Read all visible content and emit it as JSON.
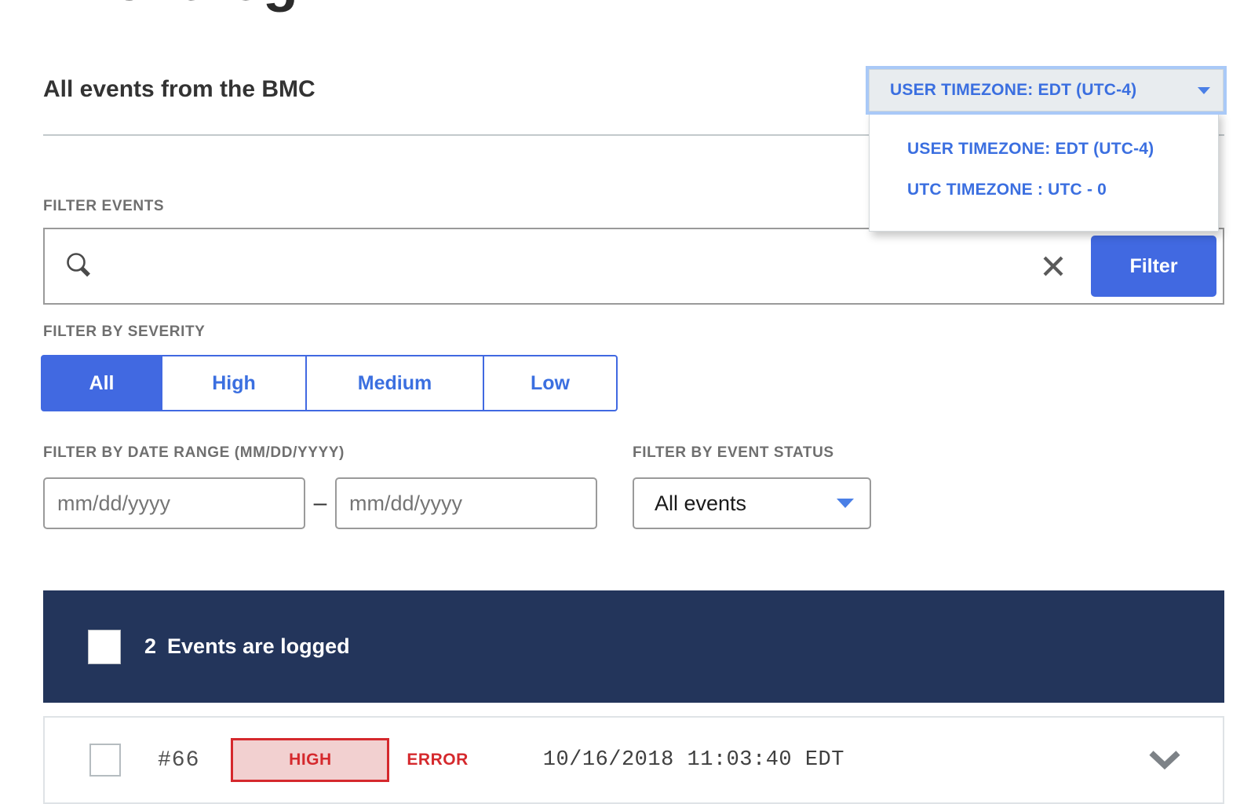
{
  "page": {
    "title": "Event log",
    "section_heading": "All events from the BMC"
  },
  "timezone": {
    "selected_label": "USER TIMEZONE: EDT (UTC-4)",
    "options": [
      "USER TIMEZONE: EDT (UTC-4)",
      "UTC TIMEZONE : UTC - 0"
    ],
    "caret_icon": "chevron-down-icon",
    "accent_color": "#3b6fe0",
    "button_background": "#e8ecef",
    "focus_ring_color": "#a9c9f7"
  },
  "filters": {
    "search": {
      "label": "FILTER EVENTS",
      "placeholder": "",
      "value": "",
      "search_icon": "search-icon",
      "clear_icon": "close-icon",
      "submit_label": "Filter",
      "submit_color": "#4169e1"
    },
    "severity": {
      "label": "FILTER BY SEVERITY",
      "options": [
        {
          "label": "All",
          "active": true
        },
        {
          "label": "High",
          "active": false
        },
        {
          "label": "Medium",
          "active": false
        },
        {
          "label": "Low",
          "active": false
        }
      ],
      "accent_color": "#4169e1"
    },
    "date_range": {
      "label": "FILTER BY DATE RANGE (MM/DD/YYYY)",
      "start_placeholder": "mm/dd/yyyy",
      "start_value": "",
      "end_placeholder": "mm/dd/yyyy",
      "end_value": "",
      "separator": "–"
    },
    "event_status": {
      "label": "FILTER BY EVENT STATUS",
      "selected": "All events",
      "caret_icon": "chevron-down-icon"
    }
  },
  "results": {
    "count": "2",
    "text": "Events are logged",
    "bar_color": "#23355b",
    "select_all_checked": false
  },
  "events": [
    {
      "id": "#66",
      "severity": "HIGH",
      "severity_color": "#d5292d",
      "severity_background": "#f2d0d0",
      "type": "ERROR",
      "timestamp": "10/16/2018 11:03:40 EDT",
      "expand_icon": "chevron-down-icon",
      "checked": false
    }
  ]
}
